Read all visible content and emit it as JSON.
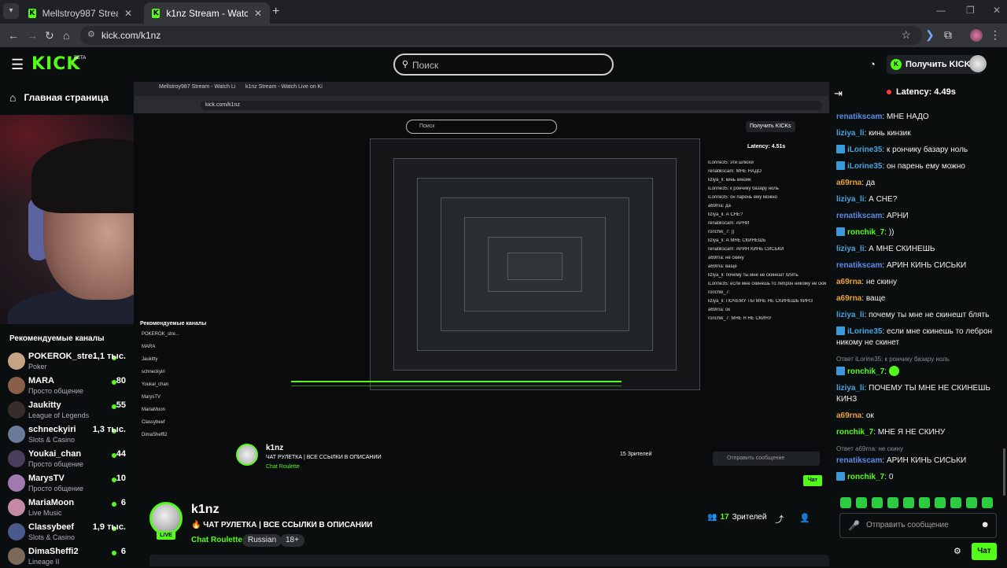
{
  "browser": {
    "tabs": [
      {
        "title": "Mellstroy987 Stream - Watch Li"
      },
      {
        "title": "k1nz Stream - Watch Live on Ki"
      }
    ],
    "url": "kick.com/k1nz"
  },
  "header": {
    "logo": "KICK",
    "beta": "BETA",
    "search_placeholder": "Поиск",
    "get_kicks": "Получить KICKs"
  },
  "sidebar": {
    "home": "Главная страница",
    "recommended_title": "Рекомендуемые каналы",
    "channels": [
      {
        "name": "POKEROK_stre...",
        "category": "Poker",
        "viewers": "1,1 тыс.",
        "color": "#c4a484"
      },
      {
        "name": "MARA",
        "category": "Просто общение",
        "viewers": "80",
        "color": "#8b5e4a"
      },
      {
        "name": "Jaukitty",
        "category": "League of Legends",
        "viewers": "55",
        "color": "#3b2c2c"
      },
      {
        "name": "schneckyiri",
        "category": "Slots & Casino",
        "viewers": "1,3 тыс.",
        "color": "#6b7a99"
      },
      {
        "name": "Youkai_chan",
        "category": "Просто общение",
        "viewers": "44",
        "color": "#4a3f5a"
      },
      {
        "name": "MarysTV",
        "category": "Просто общение",
        "viewers": "10",
        "color": "#a07ab0"
      },
      {
        "name": "MariaMoon",
        "category": "Live Music",
        "viewers": "6",
        "color": "#c48aa5"
      },
      {
        "name": "Classybeef",
        "category": "Slots & Casino",
        "viewers": "1,9 тыс.",
        "color": "#4a5a8a"
      },
      {
        "name": "DimaSheffi2",
        "category": "Lineage II",
        "viewers": "6",
        "color": "#7a6a5a"
      }
    ]
  },
  "inner": {
    "latency": "Latency: 4.51s",
    "inner_viewers": "15 Зрителей",
    "inner_msg_placeholder": "Отправить сообщение",
    "inner_chat_btn": "Чат",
    "inner_chat": [
      "iLorine35: эти шлюхи",
      "renatikscam: МНЕ НАДО",
      "liziya_li: кинь кинзик",
      "iLorine35: к рончику базару ноль",
      "iLorine35: он парень ему можно",
      "a69rna: да",
      "liziya_li: А СНЕ?",
      "renatikscam: АРНИ",
      "ronchik_7: ))",
      "liziya_li: А МНЕ СКИНЕШЬ",
      "renatikscam: АРИН КИНЬ СИСЬКИ",
      "a69rna: не скину",
      "a69rna: ваще",
      "liziya_li: почему ты мне не скинешт блять",
      "iLorine35: если мне скинешь то леброн никому не скинет",
      "ronchik_7:",
      "liziya_li: ПОЧЕМУ ТЫ МНЕ НЕ СКИНЕШЬ КИНЗ",
      "a69rna: ок",
      "ronchik_7: МНЕ Я НЕ СКИНУ"
    ]
  },
  "stream": {
    "streamer": "k1nz",
    "title": "ЧАТ РУЛЕТКА | ВСЕ ССЫЛКИ В ОПИСАНИИ",
    "category": "Chat Roulette",
    "tags": [
      "Russian",
      "18+"
    ],
    "live": "LIVE",
    "viewers_count": "17",
    "viewers_label": "Зрителей"
  },
  "chat": {
    "latency": "Latency: 4.49s",
    "messages": [
      {
        "user": "renatikscam",
        "color": "#5b8de8",
        "text": "МНЕ НАДО",
        "badge": false
      },
      {
        "user": "liziya_li",
        "color": "#4aa3df",
        "text": "кинь кинзик",
        "badge": false
      },
      {
        "user": "iLorine35",
        "color": "#4aa3df",
        "text": "к рончику базару ноль",
        "badge": true
      },
      {
        "user": "iLorine35",
        "color": "#4aa3df",
        "text": "он парень ему можно",
        "badge": true
      },
      {
        "user": "a69rna",
        "color": "#e8a33a",
        "text": "да",
        "badge": false
      },
      {
        "user": "liziya_li",
        "color": "#4aa3df",
        "text": "А СНЕ?",
        "badge": false
      },
      {
        "user": "renatikscam",
        "color": "#5b8de8",
        "text": "АРНИ",
        "badge": false
      },
      {
        "user": "ronchik_7",
        "color": "#53fc18",
        "text": "))",
        "badge": true
      },
      {
        "user": "liziya_li",
        "color": "#4aa3df",
        "text": "А МНЕ СКИНЕШЬ",
        "badge": false
      },
      {
        "user": "renatikscam",
        "color": "#5b8de8",
        "text": "АРИН КИНЬ СИСЬКИ",
        "badge": false
      },
      {
        "user": "a69rna",
        "color": "#e8a33a",
        "text": "не скину",
        "badge": false
      },
      {
        "user": "a69rna",
        "color": "#e8a33a",
        "text": "ваще",
        "badge": false
      },
      {
        "user": "liziya_li",
        "color": "#4aa3df",
        "text": "почему ты мне не скинешт блять",
        "badge": false
      },
      {
        "user": "iLorine35",
        "color": "#4aa3df",
        "text": "если мне скинешь то леброн никому не скинет",
        "badge": true
      },
      {
        "reply": "Ответ iLorine35: к рончику базару ноль",
        "user": "ronchik_7",
        "color": "#53fc18",
        "text": "",
        "badge": true,
        "emote": true
      },
      {
        "user": "liziya_li",
        "color": "#4aa3df",
        "text": "ПОЧЕМУ ТЫ МНЕ НЕ СКИНЕШЬ КИНЗ",
        "badge": false
      },
      {
        "user": "a69rna",
        "color": "#e8a33a",
        "text": "ок",
        "badge": false
      },
      {
        "user": "ronchik_7",
        "color": "#53fc18",
        "text": "МНЕ Я НЕ СКИНУ",
        "badge": false
      },
      {
        "reply": "Ответ a69rna: не скину",
        "user": "renatikscam",
        "color": "#5b8de8",
        "text": "АРИН КИНЬ СИСЬКИ",
        "badge": false
      },
      {
        "user": "ronchik_7",
        "color": "#53fc18",
        "text": "0",
        "badge": true
      }
    ],
    "input_placeholder": "Отправить сообщение",
    "send_label": "Чат"
  }
}
